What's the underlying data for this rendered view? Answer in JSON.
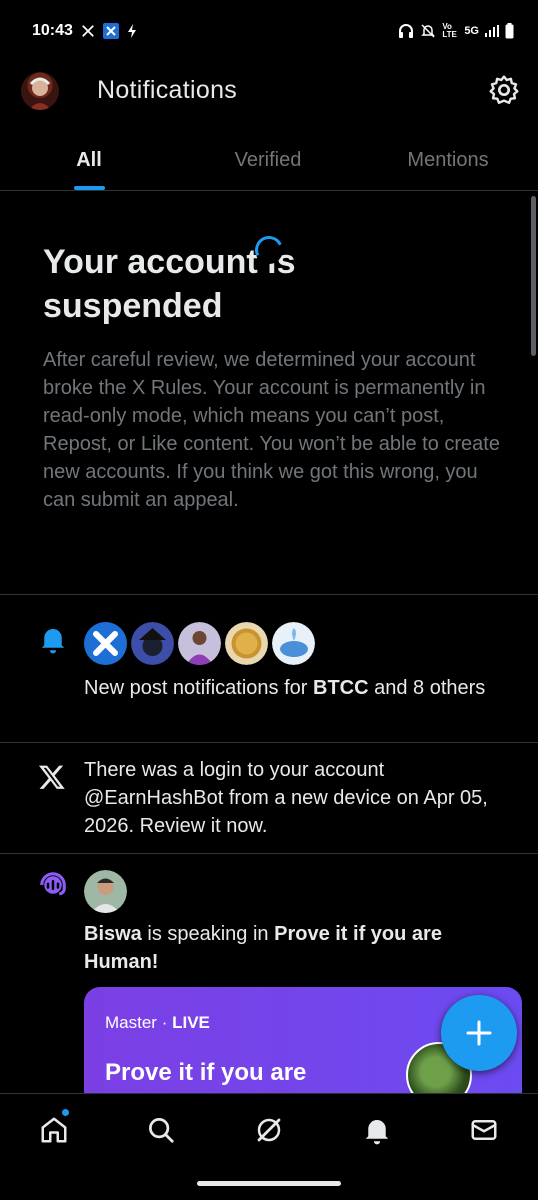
{
  "status_bar": {
    "time": "10:43",
    "network": "5G",
    "volte": "Vo LTE"
  },
  "header": {
    "title": "Notifications"
  },
  "tabs": [
    {
      "label": "All",
      "active": true
    },
    {
      "label": "Verified",
      "active": false
    },
    {
      "label": "Mentions",
      "active": false
    }
  ],
  "notice": {
    "title_line1": "Your account is",
    "title_line2": "suspended",
    "body": "After careful review, we determined your account broke the X Rules. Your account is permanently in read-only mode, which means you can’t post, Repost, or Like content. You won’t be able to create new accounts. If you think we got this wrong, you can submit an appeal."
  },
  "notifications": [
    {
      "icon": "bell-icon",
      "text_before": "New post notifications for ",
      "bold": "BTCC",
      "text_after": " and 8 others"
    },
    {
      "icon": "x-logo-icon",
      "text": "There was a login to your account @EarnHashBot from a new device on Apr 05, 2026. Review it now."
    },
    {
      "icon": "spaces-icon",
      "speaker": "Biswa",
      "middle": " is speaking in ",
      "space_name": "Prove it if you are Human!",
      "card": {
        "host": "Master",
        "separator": "·",
        "status": "LIVE",
        "title": "Prove it if you are"
      }
    }
  ],
  "colors": {
    "accent": "#1d9bf0",
    "background": "#000000",
    "muted_text": "#71767b",
    "space_card": "#7b3fe4"
  }
}
